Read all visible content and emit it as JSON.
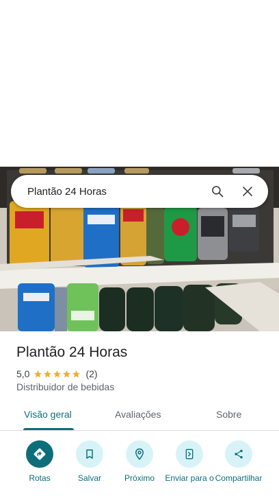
{
  "search": {
    "query": "Plantão 24 Horas"
  },
  "place": {
    "title": "Plantão 24 Horas",
    "rating": "5,0",
    "rating_value": 5,
    "review_count": "(2)",
    "category": "Distribuidor de bebidas"
  },
  "tabs": [
    {
      "label": "Visão geral",
      "active": true
    },
    {
      "label": "Avaliações",
      "active": false
    },
    {
      "label": "Sobre",
      "active": false
    }
  ],
  "actions": [
    {
      "label": "Rotas",
      "icon": "directions-icon"
    },
    {
      "label": "Salvar",
      "icon": "bookmark-icon"
    },
    {
      "label": "Próximo",
      "icon": "nearby-icon"
    },
    {
      "label": "Enviar para o",
      "icon": "send-to-phone-icon"
    },
    {
      "label": "Compartilhar",
      "icon": "share-icon"
    }
  ],
  "colors": {
    "accent": "#0b6e7a",
    "action_bg": "#d7f3f7",
    "star": "#f2b01e"
  }
}
